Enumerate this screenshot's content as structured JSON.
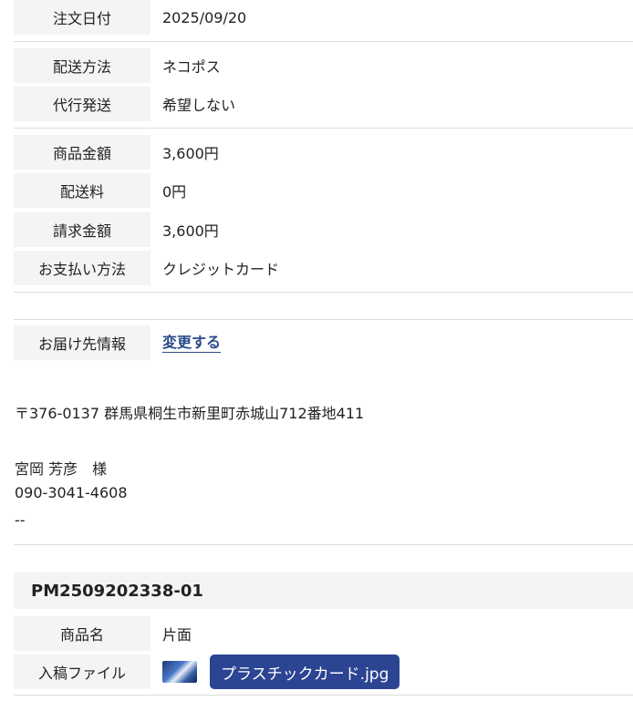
{
  "order_info": [
    {
      "label": "注文日付",
      "value": "2025/09/20"
    }
  ],
  "shipping": [
    {
      "label": "配送方法",
      "value": "ネコポス"
    },
    {
      "label": "代行発送",
      "value": "希望しない"
    }
  ],
  "payment": [
    {
      "label": "商品金額",
      "value": "3,600円"
    },
    {
      "label": "配送料",
      "value": "0円"
    },
    {
      "label": "請求金額",
      "value": "3,600円"
    },
    {
      "label": "お支払い方法",
      "value": "クレジットカード"
    }
  ],
  "delivery": {
    "label": "お届け先情報",
    "change_link": "変更する",
    "address": "〒376-0137 群馬県桐生市新里町赤城山712番地411",
    "name": "宮岡 芳彦　様",
    "phone": "090-3041-4608",
    "extra": "--"
  },
  "order_item": {
    "order_number": "PM2509202338-01",
    "product_label": "商品名",
    "product_value": "片面",
    "file_label": "入稿ファイル",
    "file_name": "プラスチックカード.jpg"
  },
  "colors": {
    "label_bg": "#f4f4f4",
    "link": "#2a4a8a",
    "file_button": "#2b4592",
    "divider": "#dcdcdc"
  }
}
